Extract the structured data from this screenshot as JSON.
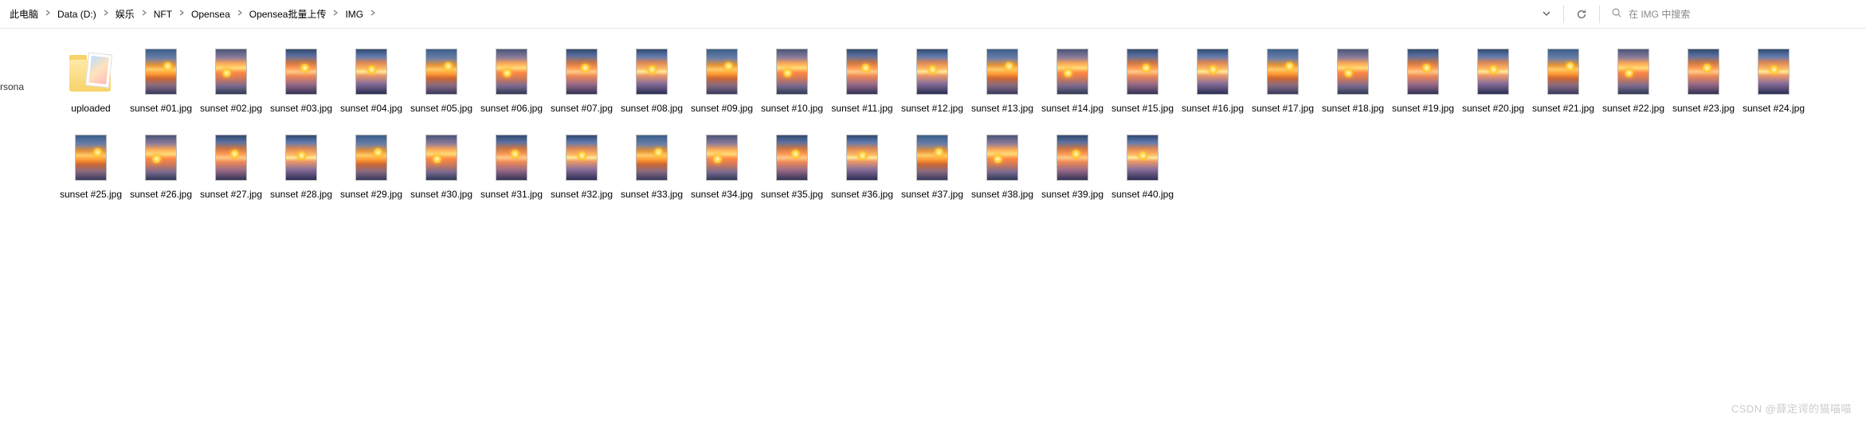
{
  "breadcrumb": {
    "segments": [
      "此电脑",
      "Data (D:)",
      "娱乐",
      "NFT",
      "Opensea",
      "Opensea批量上传",
      "IMG"
    ]
  },
  "search": {
    "placeholder": "在 IMG 中搜索"
  },
  "sidebar_fragment": "rsona",
  "folder": {
    "name": "uploaded"
  },
  "files": [
    {
      "name": "sunset #01.jpg"
    },
    {
      "name": "sunset #02.jpg"
    },
    {
      "name": "sunset #03.jpg"
    },
    {
      "name": "sunset #04.jpg"
    },
    {
      "name": "sunset #05.jpg"
    },
    {
      "name": "sunset #06.jpg"
    },
    {
      "name": "sunset #07.jpg"
    },
    {
      "name": "sunset #08.jpg"
    },
    {
      "name": "sunset #09.jpg"
    },
    {
      "name": "sunset #10.jpg"
    },
    {
      "name": "sunset #11.jpg"
    },
    {
      "name": "sunset #12.jpg"
    },
    {
      "name": "sunset #13.jpg"
    },
    {
      "name": "sunset #14.jpg"
    },
    {
      "name": "sunset #15.jpg"
    },
    {
      "name": "sunset #16.jpg"
    },
    {
      "name": "sunset #17.jpg"
    },
    {
      "name": "sunset #18.jpg"
    },
    {
      "name": "sunset #19.jpg"
    },
    {
      "name": "sunset #20.jpg"
    },
    {
      "name": "sunset #21.jpg"
    },
    {
      "name": "sunset #22.jpg"
    },
    {
      "name": "sunset #23.jpg"
    },
    {
      "name": "sunset #24.jpg"
    },
    {
      "name": "sunset #25.jpg"
    },
    {
      "name": "sunset #26.jpg"
    },
    {
      "name": "sunset #27.jpg"
    },
    {
      "name": "sunset #28.jpg"
    },
    {
      "name": "sunset #29.jpg"
    },
    {
      "name": "sunset #30.jpg"
    },
    {
      "name": "sunset #31.jpg"
    },
    {
      "name": "sunset #32.jpg"
    },
    {
      "name": "sunset #33.jpg"
    },
    {
      "name": "sunset #34.jpg"
    },
    {
      "name": "sunset #35.jpg"
    },
    {
      "name": "sunset #36.jpg"
    },
    {
      "name": "sunset #37.jpg"
    },
    {
      "name": "sunset #38.jpg"
    },
    {
      "name": "sunset #39.jpg"
    },
    {
      "name": "sunset #40.jpg"
    }
  ],
  "watermark": "CSDN @薛定谔的猫喵喵"
}
